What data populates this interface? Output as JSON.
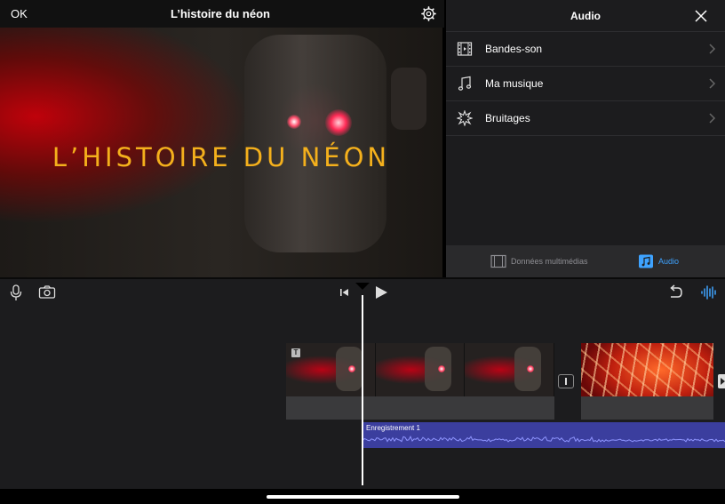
{
  "viewer": {
    "ok_label": "OK",
    "project_title": "L’histoire du néon",
    "settings_icon": "gear-icon",
    "video_title_text": "L’HISTOIRE DU NÉON"
  },
  "audio_panel": {
    "title": "Audio",
    "close_icon": "close-icon",
    "items": [
      {
        "label": "Bandes-son",
        "icon": "film-strip-icon"
      },
      {
        "label": "Ma musique",
        "icon": "music-note-icon"
      },
      {
        "label": "Bruitages",
        "icon": "burst-icon"
      }
    ],
    "tabs": [
      {
        "label": "Données multimédias",
        "icon": "media-icon",
        "active": false
      },
      {
        "label": "Audio",
        "icon": "audio-icon",
        "active": true
      }
    ]
  },
  "timeline": {
    "toolbar": {
      "mic_icon": "microphone-icon",
      "camera_icon": "camera-icon",
      "skip_back_icon": "skip-to-start-icon",
      "play_icon": "play-icon",
      "undo_icon": "undo-icon",
      "waveform_icon": "waveform-icon"
    },
    "title_badge": "T",
    "audio_clip_label": "Enregistrement 1"
  },
  "colors": {
    "title_gold": "#f4b01c",
    "accent_blue": "#3ea3ff",
    "audio_track": "#3b3e9e",
    "waveform": "#8f95ff"
  }
}
